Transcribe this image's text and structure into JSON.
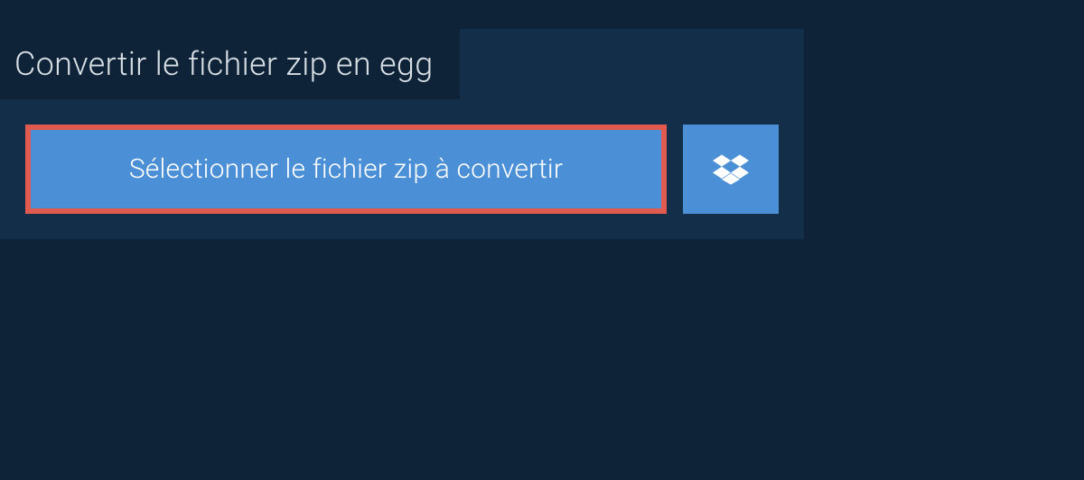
{
  "header": {
    "title": "Convertir le fichier zip en egg"
  },
  "actions": {
    "select_file_label": "Sélectionner le fichier zip à convertir"
  },
  "colors": {
    "bg_outer": "#0f2338",
    "bg_panel": "#132e48",
    "button_bg": "#4b8fd6",
    "button_border": "#e05a4f",
    "text_light": "#d8dfe4",
    "text_white": "#ffffff"
  }
}
